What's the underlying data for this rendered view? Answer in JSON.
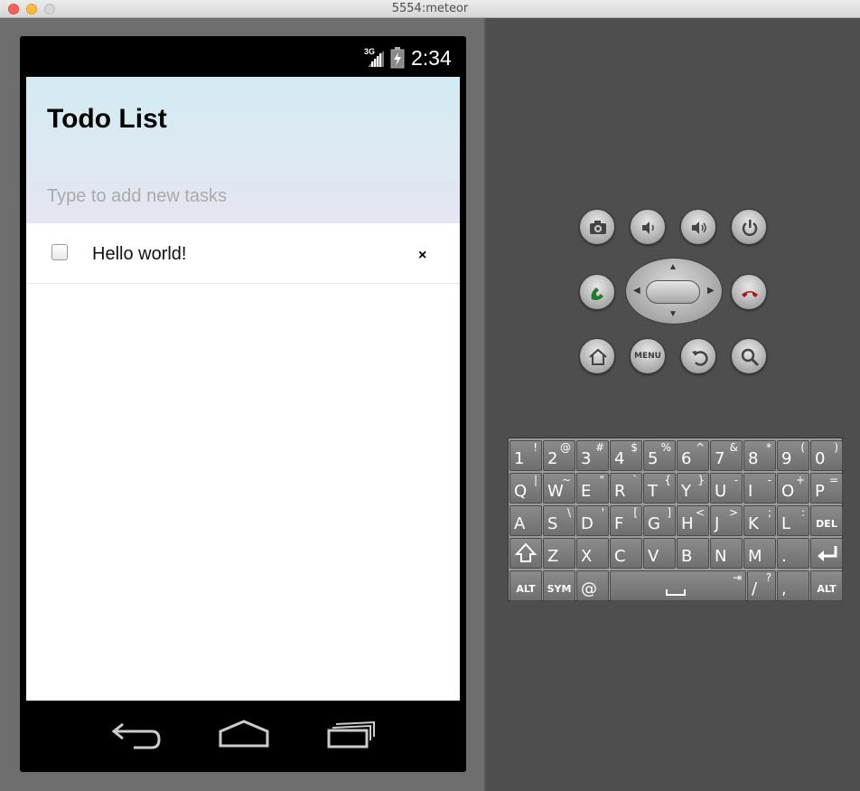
{
  "window": {
    "title": "5554:meteor"
  },
  "status_bar": {
    "network": "3G",
    "time": "2:34"
  },
  "app": {
    "title": "Todo List",
    "input_placeholder": "Type to add new tasks",
    "tasks": [
      {
        "text": "Hello world!",
        "checked": false,
        "delete_label": "×"
      }
    ]
  },
  "controls": {
    "menu_label": "MENU",
    "keyboard": {
      "row1": [
        {
          "main": "1",
          "alt": "!"
        },
        {
          "main": "2",
          "alt": "@"
        },
        {
          "main": "3",
          "alt": "#"
        },
        {
          "main": "4",
          "alt": "$"
        },
        {
          "main": "5",
          "alt": "%"
        },
        {
          "main": "6",
          "alt": "^"
        },
        {
          "main": "7",
          "alt": "&"
        },
        {
          "main": "8",
          "alt": "*"
        },
        {
          "main": "9",
          "alt": "("
        },
        {
          "main": "0",
          "alt": ")"
        }
      ],
      "row2": [
        {
          "main": "Q",
          "alt": "|"
        },
        {
          "main": "W",
          "alt": "~"
        },
        {
          "main": "E",
          "alt": "\""
        },
        {
          "main": "R",
          "alt": "`"
        },
        {
          "main": "T",
          "alt": "{"
        },
        {
          "main": "Y",
          "alt": "}"
        },
        {
          "main": "U",
          "alt": "-"
        },
        {
          "main": "I",
          "alt": "-"
        },
        {
          "main": "O",
          "alt": "+"
        },
        {
          "main": "P",
          "alt": "="
        }
      ],
      "row3": [
        {
          "main": "A",
          "alt": ""
        },
        {
          "main": "S",
          "alt": "\\"
        },
        {
          "main": "D",
          "alt": "'"
        },
        {
          "main": "F",
          "alt": "["
        },
        {
          "main": "G",
          "alt": "]"
        },
        {
          "main": "H",
          "alt": "<"
        },
        {
          "main": "J",
          "alt": ">"
        },
        {
          "main": "K",
          "alt": ";"
        },
        {
          "main": "L",
          "alt": ":"
        }
      ],
      "del_label": "DEL",
      "row4": [
        {
          "main": "Z",
          "alt": ""
        },
        {
          "main": "X",
          "alt": ""
        },
        {
          "main": "C",
          "alt": ""
        },
        {
          "main": "V",
          "alt": ""
        },
        {
          "main": "B",
          "alt": ""
        },
        {
          "main": "N",
          "alt": ""
        },
        {
          "main": "M",
          "alt": ""
        },
        {
          "main": ".",
          "alt": ""
        }
      ],
      "alt_label": "ALT",
      "sym_label": "SYM",
      "at_label": "@",
      "slash": {
        "main": "/",
        "alt": "?"
      },
      "comma": ",",
      "space_tab": "⇥"
    }
  }
}
